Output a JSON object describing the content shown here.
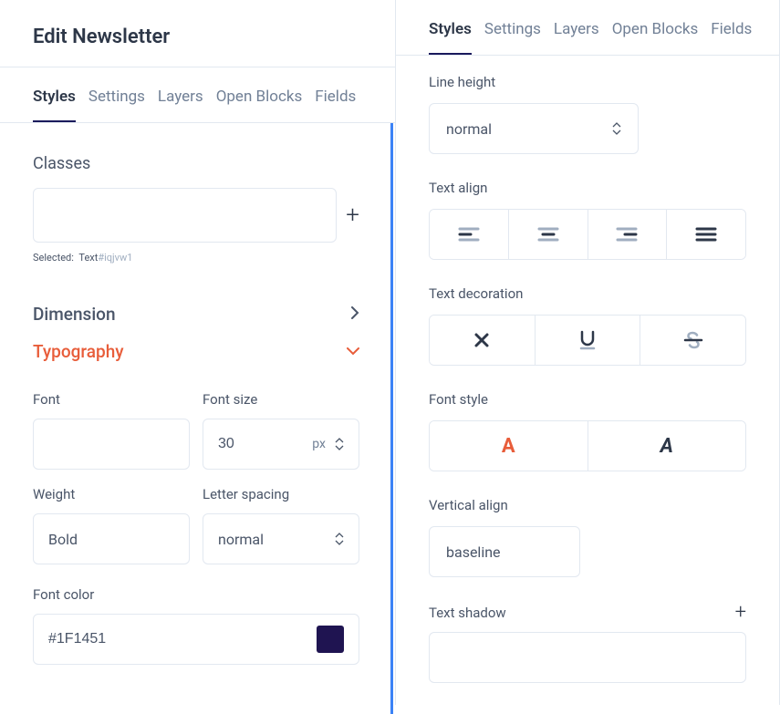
{
  "header": {
    "title": "Edit Newsletter"
  },
  "tabs_left": [
    "Styles",
    "Settings",
    "Layers",
    "Open Blocks",
    "Fields"
  ],
  "tabs_left_active": 0,
  "tabs_right": [
    "Styles",
    "Settings",
    "Layers",
    "Open Blocks",
    "Fields"
  ],
  "tabs_right_active": 0,
  "left": {
    "classes_label": "Classes",
    "classes_value": "",
    "selected_prefix": "Selected:",
    "selected_text": "Text",
    "selected_id": "#iqjvw1",
    "dimension_label": "Dimension",
    "typography_label": "Typography",
    "font_label": "Font",
    "font_value": "",
    "font_size_label": "Font size",
    "font_size_value": "30",
    "font_size_unit": "px",
    "weight_label": "Weight",
    "weight_value": "Bold",
    "letter_spacing_label": "Letter spacing",
    "letter_spacing_value": "normal",
    "font_color_label": "Font color",
    "font_color_value": "#1F1451",
    "font_color_hex": "#1F1451"
  },
  "right": {
    "line_height_label": "Line height",
    "line_height_value": "normal",
    "text_align_label": "Text align",
    "text_decoration_label": "Text decoration",
    "font_style_label": "Font style",
    "vertical_align_label": "Vertical align",
    "vertical_align_value": "baseline",
    "text_shadow_label": "Text shadow"
  }
}
